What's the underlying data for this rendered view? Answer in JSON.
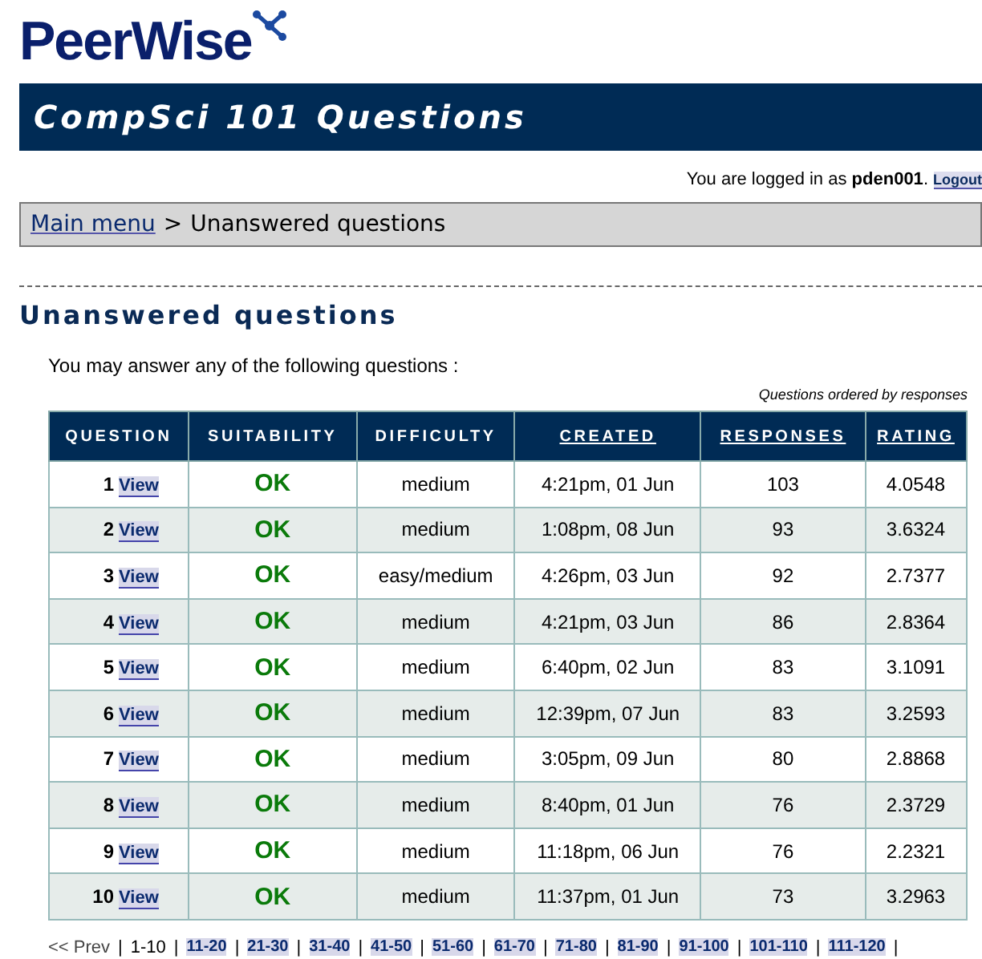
{
  "logo": {
    "text": "PeerWise"
  },
  "banner": {
    "title": "CompSci 101 Questions"
  },
  "login": {
    "prefix": "You are logged in as",
    "user": "pden001",
    "suffix": ".",
    "logout": "Logout"
  },
  "breadcrumb": {
    "link": "Main menu",
    "separator": ">",
    "current": "Unanswered questions"
  },
  "heading": "Unanswered questions",
  "intro": "You may answer any of the following questions :",
  "order_note": "Questions ordered by responses",
  "table": {
    "columns": [
      {
        "label": "QUESTION",
        "sortable": false
      },
      {
        "label": "SUITABILITY",
        "sortable": false
      },
      {
        "label": "DIFFICULTY",
        "sortable": false
      },
      {
        "label": "CREATED",
        "sortable": true
      },
      {
        "label": "RESPONSES",
        "sortable": true
      },
      {
        "label": "RATING",
        "sortable": true
      }
    ],
    "rows": [
      {
        "number": "1",
        "link": "View",
        "suitability": "OK",
        "difficulty": "medium",
        "created": "4:21pm, 01 Jun",
        "responses": "103",
        "rating": "4.0548"
      },
      {
        "number": "2",
        "link": "View",
        "suitability": "OK",
        "difficulty": "medium",
        "created": "1:08pm, 08 Jun",
        "responses": "93",
        "rating": "3.6324"
      },
      {
        "number": "3",
        "link": "View",
        "suitability": "OK",
        "difficulty": "easy/medium",
        "created": "4:26pm, 03 Jun",
        "responses": "92",
        "rating": "2.7377"
      },
      {
        "number": "4",
        "link": "View",
        "suitability": "OK",
        "difficulty": "medium",
        "created": "4:21pm, 03 Jun",
        "responses": "86",
        "rating": "2.8364"
      },
      {
        "number": "5",
        "link": "View",
        "suitability": "OK",
        "difficulty": "medium",
        "created": "6:40pm, 02 Jun",
        "responses": "83",
        "rating": "3.1091"
      },
      {
        "number": "6",
        "link": "View",
        "suitability": "OK",
        "difficulty": "medium",
        "created": "12:39pm, 07 Jun",
        "responses": "83",
        "rating": "3.2593"
      },
      {
        "number": "7",
        "link": "View",
        "suitability": "OK",
        "difficulty": "medium",
        "created": "3:05pm, 09 Jun",
        "responses": "80",
        "rating": "2.8868"
      },
      {
        "number": "8",
        "link": "View",
        "suitability": "OK",
        "difficulty": "medium",
        "created": "8:40pm, 01 Jun",
        "responses": "76",
        "rating": "2.3729"
      },
      {
        "number": "9",
        "link": "View",
        "suitability": "OK",
        "difficulty": "medium",
        "created": "11:18pm, 06 Jun",
        "responses": "76",
        "rating": "2.2321"
      },
      {
        "number": "10",
        "link": "View",
        "suitability": "OK",
        "difficulty": "medium",
        "created": "11:37pm, 01 Jun",
        "responses": "73",
        "rating": "3.2963"
      }
    ]
  },
  "pagination": {
    "prev": "<< Prev",
    "prev_disabled": true,
    "separator": "|",
    "pages": [
      {
        "label": "1-10",
        "selected": true
      },
      {
        "label": "11-20",
        "selected": false
      },
      {
        "label": "21-30",
        "selected": false
      },
      {
        "label": "31-40",
        "selected": false
      },
      {
        "label": "41-50",
        "selected": false
      },
      {
        "label": "51-60",
        "selected": false
      },
      {
        "label": "61-70",
        "selected": false
      },
      {
        "label": "71-80",
        "selected": false
      },
      {
        "label": "81-90",
        "selected": false
      },
      {
        "label": "91-100",
        "selected": false
      },
      {
        "label": "101-110",
        "selected": false
      },
      {
        "label": "111-120",
        "selected": false
      }
    ]
  }
}
